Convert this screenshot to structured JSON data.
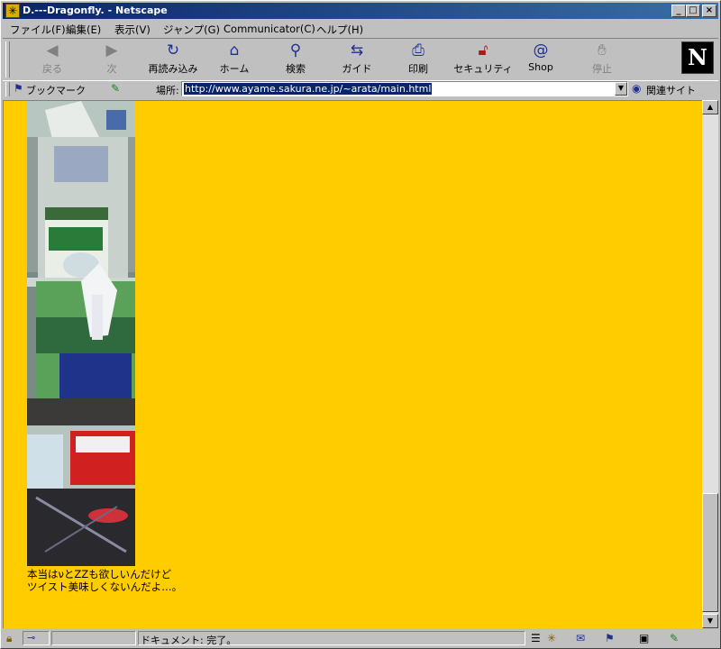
{
  "window": {
    "title": "D.---Dragonfly. - Netscape",
    "controls": {
      "minimize": "_",
      "maximize": "□",
      "close": "×"
    }
  },
  "menu": [
    "ファイル(F)",
    "編集(E)",
    "表示(V)",
    "ジャンプ(G)",
    "Communicator(C)",
    "ヘルプ(H)"
  ],
  "toolbar": {
    "back": "戻る",
    "forward": "次",
    "reload": "再読み込み",
    "home": "ホーム",
    "search": "検索",
    "guide": "ガイド",
    "print": "印刷",
    "security": "セキュリティ",
    "shop": "Shop",
    "stop": "停止",
    "logo": "N"
  },
  "location": {
    "bookmarks_label": "ブックマーク",
    "label": "場所:",
    "url": "http://www.ayame.sakura.ne.jp/~arata/main.html",
    "related_label": "関連サイト"
  },
  "page": {
    "background": "#ffcc00",
    "caption_line1": "本当はνとZZも欲しいんだけど",
    "caption_line2": "ツイスト美味しくないんだよ…。"
  },
  "status": {
    "text": "ドキュメント: 完了。"
  },
  "colors": {
    "titlebar": "#0a246a",
    "chrome": "#c0c0c0"
  }
}
